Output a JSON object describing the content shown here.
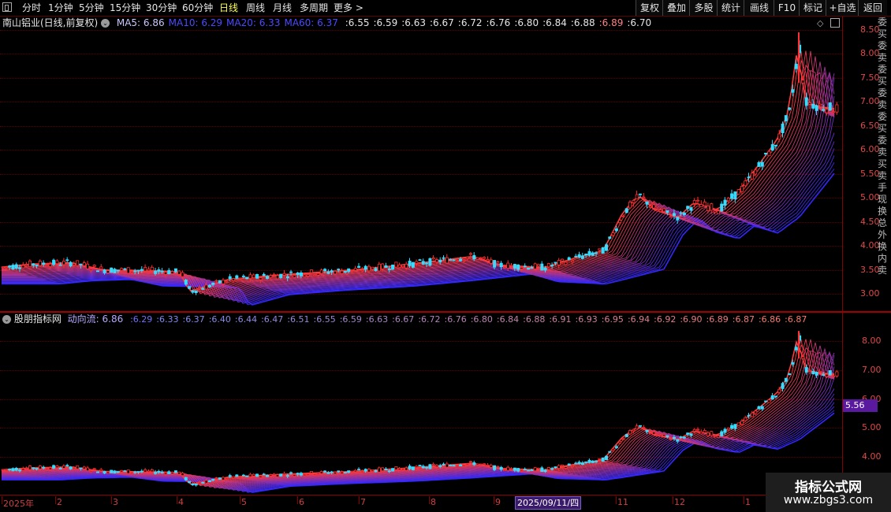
{
  "toolbar": {
    "periods": [
      "分时",
      "1分钟",
      "5分钟",
      "15分钟",
      "30分钟",
      "60分钟",
      "日线",
      "周线",
      "月线",
      "多周期",
      "更多 >"
    ],
    "active_period": "日线",
    "right_buttons": [
      "复权",
      "叠加",
      "多股",
      "统计",
      "画线",
      "F10",
      "标记",
      "+自选",
      "返回"
    ]
  },
  "main_panel": {
    "title": "南山铝业(日线,前复权)",
    "ma_labels": [
      {
        "text": "MA5: 6.86",
        "color": "#c8c8ff"
      },
      {
        "text": "MA10: 6.29",
        "color": "#4a4aff"
      },
      {
        "text": "MA20: 6.33",
        "color": "#4a4aff"
      },
      {
        "text": "MA60: 6.37",
        "color": "#4a4aff"
      }
    ],
    "extra_values": [
      ":6.55",
      ":6.59",
      ":6.63",
      ":6.67",
      ":6.72",
      ":6.76",
      ":6.80",
      ":6.84",
      ":6.88",
      ":6.89",
      ":6.70"
    ],
    "y_ticks": [
      "8.50",
      "8.00",
      "7.50",
      "7.00",
      "6.50",
      "6.00",
      "5.50",
      "5.00",
      "4.50",
      "4.00",
      "3.50",
      "3.00"
    ]
  },
  "sub_panel": {
    "title": "股朋指标网",
    "indicator_label": "动向流: 6.86",
    "values": [
      ":6.29",
      ":6.33",
      ":6.37",
      ":6.40",
      ":6.44",
      ":6.47",
      ":6.51",
      ":6.55",
      ":6.59",
      ":6.63",
      ":6.67",
      ":6.72",
      ":6.76",
      ":6.80",
      ":6.84",
      ":6.88",
      ":6.91",
      ":6.93",
      ":6.95",
      ":6.94",
      ":6.92",
      ":6.90",
      ":6.89",
      ":6.87",
      ":6.86",
      ":6.87"
    ],
    "y_ticks": [
      "8.00",
      "7.00",
      "6.00",
      "5.00",
      "4.00"
    ],
    "price_tag": "5.56"
  },
  "x_axis": {
    "labels": [
      "2025年",
      "2",
      "3",
      "4",
      "5",
      "6",
      "7",
      "8",
      "9",
      "11",
      "12",
      "1"
    ],
    "cursor_date": "2025/09/11/四"
  },
  "side_strip_text": "委买委卖委买委卖委买委卖买卖手现换总外换内卖",
  "watermark": {
    "title": "指标公式网",
    "url": "www.zbgs3.com"
  },
  "colors": {
    "up": "#ff3030",
    "down": "#33ddff",
    "axis": "#e04848",
    "grid": "#5a0000",
    "ma_fast": "#ff3030",
    "ma_slow": "#3030ff"
  },
  "chart_data": {
    "type": "candlestick",
    "series_name": "南山铝业",
    "x": [
      "2025年",
      "2",
      "3",
      "4",
      "5",
      "6",
      "7",
      "8",
      "9",
      "11",
      "12",
      "1"
    ],
    "close_trend": [
      3.55,
      3.65,
      3.45,
      3.4,
      3.1,
      3.35,
      3.45,
      3.5,
      3.6,
      3.75,
      3.95,
      3.65,
      3.85,
      4.7,
      4.65,
      4.7,
      5.1,
      5.7,
      6.4,
      8.4,
      6.9,
      6.86
    ],
    "ylim": [
      2.85,
      8.65
    ],
    "sub_ylim": [
      3.5,
      8.6
    ]
  }
}
